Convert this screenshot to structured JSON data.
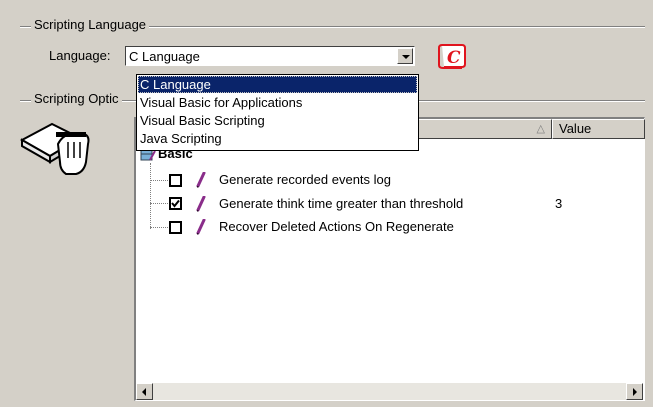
{
  "scripting_language": {
    "group_title": "Scripting Language",
    "language_label": "Language:",
    "selected_value": "C Language",
    "options": [
      "C Language",
      "Visual Basic for Applications",
      "Visual Basic Scripting",
      "Java Scripting"
    ]
  },
  "scripting_options": {
    "group_title": "Scripting Optic",
    "columns": [
      "",
      "Value"
    ],
    "sort_indicator": "△",
    "category": "Basic",
    "rows": [
      {
        "label": "Generate recorded events log",
        "checked": false,
        "value": ""
      },
      {
        "label": "Generate think time greater than threshold",
        "checked": true,
        "value": "3"
      },
      {
        "label": "Recover Deleted Actions On Regenerate",
        "checked": false,
        "value": ""
      }
    ]
  },
  "icons": {
    "c_language_icon": "script-c-icon",
    "book_hand_icon": "book-hand-icon",
    "pencil_icon": "pencil-icon"
  },
  "colors": {
    "selection": "#0a246a",
    "panel_bg": "#d4d0c8",
    "pencil": "#8a2d8a",
    "c_icon": "#e0141e"
  }
}
